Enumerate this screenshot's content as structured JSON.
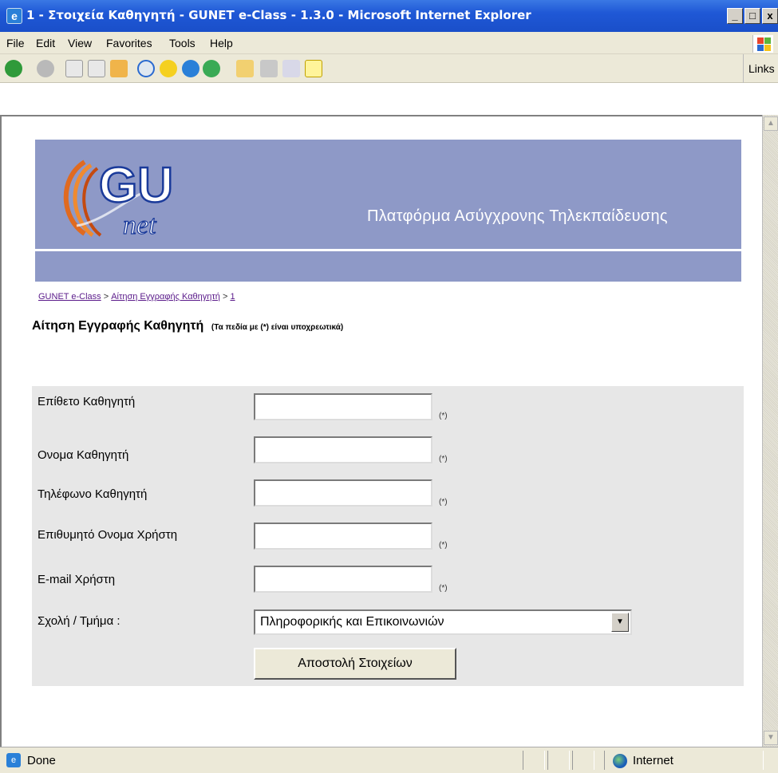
{
  "window": {
    "title": "1 - Στοιχεία Καθηγητή - GUNET e-Class - 1.3.0 - Microsoft Internet Explorer",
    "minimize": "_",
    "maximize": "□",
    "close": "x"
  },
  "menu": [
    "File",
    "Edit",
    "View",
    "Favorites",
    "Tools",
    "Help"
  ],
  "toolbar": {
    "links_label": "Links"
  },
  "banner": {
    "logo_text_top": "GU",
    "logo_text_bottom": "net",
    "tagline": "Πλατφόρμα Ασύγχρονης Τηλεκπαίδευσης"
  },
  "breadcrumb": {
    "home": "GUNET e-Class",
    "sep1": ">",
    "section": "Αίτηση Εγγραφής Καθηγητή",
    "sep2": ">",
    "current": "1"
  },
  "heading": {
    "title": "Αίτηση Εγγραφής Καθηγητή",
    "note": "(Τα πεδία με (*) είναι υποχρεωτικά)"
  },
  "form": {
    "fields": [
      {
        "label": "Επίθετο Καθηγητή",
        "value": "",
        "required": "(*)"
      },
      {
        "label": "Ονομα Καθηγητή",
        "value": "",
        "required": "(*)"
      },
      {
        "label": "Τηλέφωνο Καθηγητή",
        "value": "",
        "required": "(*)"
      },
      {
        "label": "Επιθυμητό Ονομα Χρήστη",
        "value": "",
        "required": "(*)"
      },
      {
        "label": "E-mail Χρήστη",
        "value": "",
        "required": "(*)"
      }
    ],
    "department_label": "Σχολή / Τμήμα :",
    "department_value": "Πληροφορικής και Επικοινωνιών",
    "submit_label": "Αποστολή Στοιχείων"
  },
  "status": {
    "text": "Done",
    "zone": "Internet"
  },
  "colors": {
    "banner": "#8e99c7",
    "form_panel": "#e7e7e7",
    "link": "#5a1a8a",
    "titlebar": "#1f58d6"
  }
}
